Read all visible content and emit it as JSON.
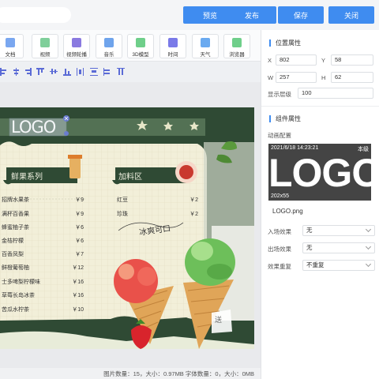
{
  "header": {
    "buttons": [
      {
        "label": "预览"
      },
      {
        "label": "发布"
      },
      {
        "label": "保存"
      },
      {
        "label": "关闭"
      }
    ]
  },
  "toolbar": {
    "tools": [
      {
        "label": "文档",
        "icon": "document-icon",
        "color": "#7aa7f0"
      },
      {
        "label": "视频",
        "icon": "video-icon",
        "color": "#7fcf9a"
      },
      {
        "label": "视频轮播",
        "icon": "video-carousel-icon",
        "color": "#8a7ae0"
      },
      {
        "label": "音乐",
        "icon": "music-icon",
        "color": "#6fa4ec"
      },
      {
        "label": "3D模型",
        "icon": "cube-icon",
        "color": "#6fcf8a"
      },
      {
        "label": "时间",
        "icon": "clock-icon",
        "color": "#7a7ae8"
      },
      {
        "label": "天气",
        "icon": "weather-icon",
        "color": "#6aaaf0"
      },
      {
        "label": "浏览器",
        "icon": "browser-icon",
        "color": "#6fcf8a"
      }
    ]
  },
  "canvas": {
    "logo_text": "LOGO",
    "section_left": "鲜果系列",
    "section_right": "加料区",
    "stamp": "冰爽可口",
    "menu_left": [
      {
        "name": "招牌水果茶",
        "price": "￥9"
      },
      {
        "name": "满杯百香果",
        "price": "￥9"
      },
      {
        "name": "蜂蜜柚子茶",
        "price": "￥6"
      },
      {
        "name": "金桔柠檬",
        "price": "￥6"
      },
      {
        "name": "百香凤梨",
        "price": "￥7"
      },
      {
        "name": "鲜橙葡萄柚",
        "price": "￥12"
      },
      {
        "name": "士多啤梨柠檬味",
        "price": "￥16"
      },
      {
        "name": "草莓长岛冰茶",
        "price": "￥16"
      },
      {
        "name": "苦瓜水柠茶",
        "price": "￥10"
      }
    ],
    "menu_right": [
      {
        "name": "红豆",
        "price": "￥2"
      },
      {
        "name": "珍珠",
        "price": "￥2"
      }
    ],
    "send_label": "送"
  },
  "status": {
    "text": "图片数量：15，大小：0.97MB    字体数量：0，大小：0MB"
  },
  "panel": {
    "position_title": "位置属性",
    "x_label": "X",
    "x_value": "802",
    "y_label": "Y",
    "y_value": "58",
    "w_label": "W",
    "w_value": "257",
    "h_label": "H",
    "h_value": "62",
    "layer_label": "显示层级",
    "layer_value": "100",
    "component_title": "组件属性",
    "anim_label": "动画配置",
    "preview_timestamp": "2021/6/18 14:23:21",
    "preview_tag": "本级",
    "preview_logo": "LOGO",
    "preview_size": "202x55",
    "filename": "LOGO.png",
    "enter_label": "入场效果",
    "enter_value": "无",
    "exit_label": "出场效果",
    "exit_value": "无",
    "repeat_label": "效果重复",
    "repeat_value": "不重复"
  }
}
